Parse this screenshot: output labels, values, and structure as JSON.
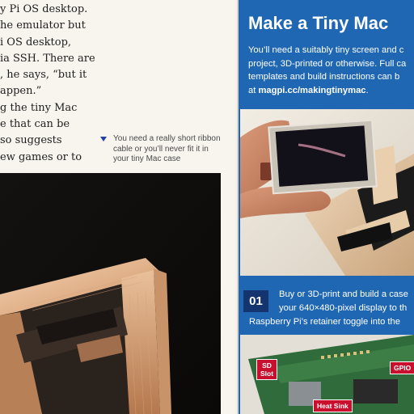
{
  "article": {
    "body_lines": [
      "y Pi OS desktop.",
      "he emulator but",
      "i OS desktop,",
      "ia SSH. There are",
      ", he says, “but it",
      "appen.”",
      "g the tiny Mac",
      "e that can be",
      "so suggests",
      "ew games or to"
    ],
    "caption": "You need a really short ribbon cable or you’ll never fit it in your tiny Mac case"
  },
  "sidebar": {
    "title": "Make a Tiny Mac",
    "intro_lines": [
      "You’ll need a suitably tiny screen and c",
      "project, 3D-printed or otherwise. Full ca",
      "templates and build instructions can b"
    ],
    "intro_prefix": "at ",
    "intro_link": "magpi.cc/makingtinymac",
    "intro_suffix": ".",
    "step": {
      "number": "01",
      "lines": [
        "Buy or 3D-print and build a case",
        "your 640×480-pixel display to th",
        "Raspberry Pi’s retainer toggle into the"
      ]
    },
    "board_labels": {
      "sd_slot_line1": "SD",
      "sd_slot_line2": "Slot",
      "gpio": "GPIO",
      "heat_sink": "Heat Sink"
    }
  },
  "colors": {
    "sidebar_blue": "#1f67b3",
    "step_box": "#14346f",
    "label_red": "#c8102e",
    "caption_marker": "#1f3fa6"
  }
}
